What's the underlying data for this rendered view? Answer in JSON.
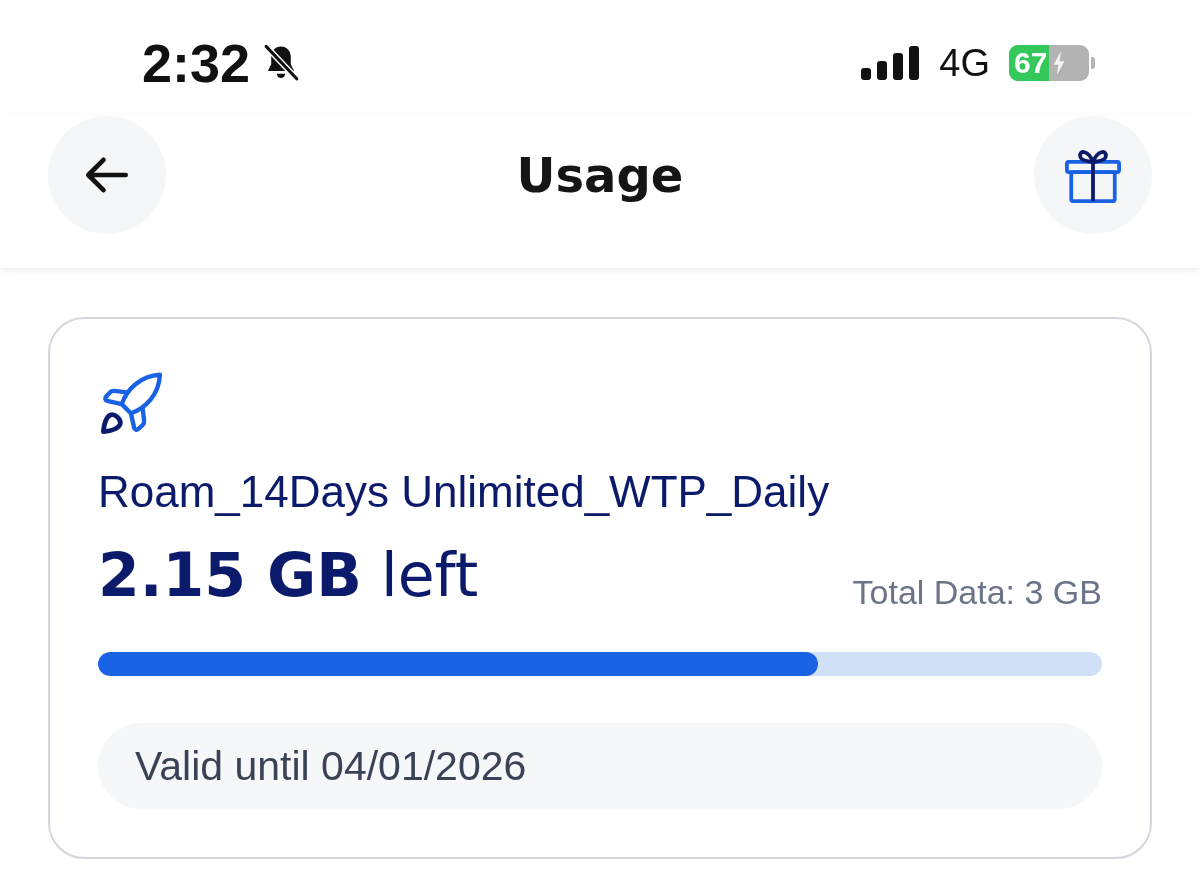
{
  "status_bar": {
    "time": "2:32",
    "silent": true,
    "network": "4G",
    "battery": "67",
    "charging": true
  },
  "header": {
    "title": "Usage"
  },
  "plan": {
    "name": "Roam_14Days Unlimited_WTP_Daily",
    "remaining": "**2.15 GB** left",
    "total": "Total Data: 3 GB",
    "level": 0.717,
    "validity": "Valid until 04/01/2026"
  }
}
